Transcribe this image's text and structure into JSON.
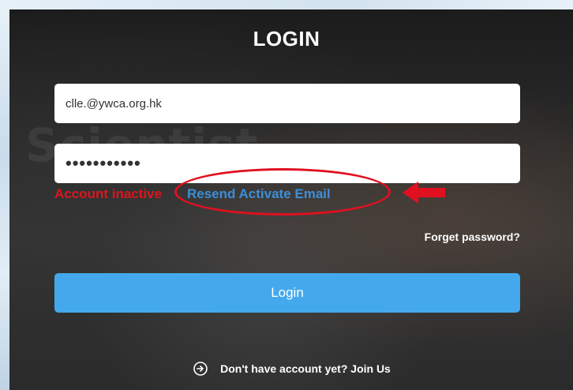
{
  "page": {
    "title": "LOGIN",
    "background_word": "Scientist"
  },
  "form": {
    "email_value": "clle.@ywca.org.hk",
    "password_value": "•••••••••••",
    "status_message": "Account inactive",
    "resend_link": "Resend Activate Email",
    "forget_password": "Forget password?",
    "login_button": "Login"
  },
  "footer": {
    "join_text": "Don't have account yet? Join Us",
    "icon": "arrow-circle-right-icon"
  },
  "colors": {
    "error": "#e0141c",
    "link": "#3b8fd8",
    "button": "#44a9ec",
    "annotation": "#e01020"
  }
}
